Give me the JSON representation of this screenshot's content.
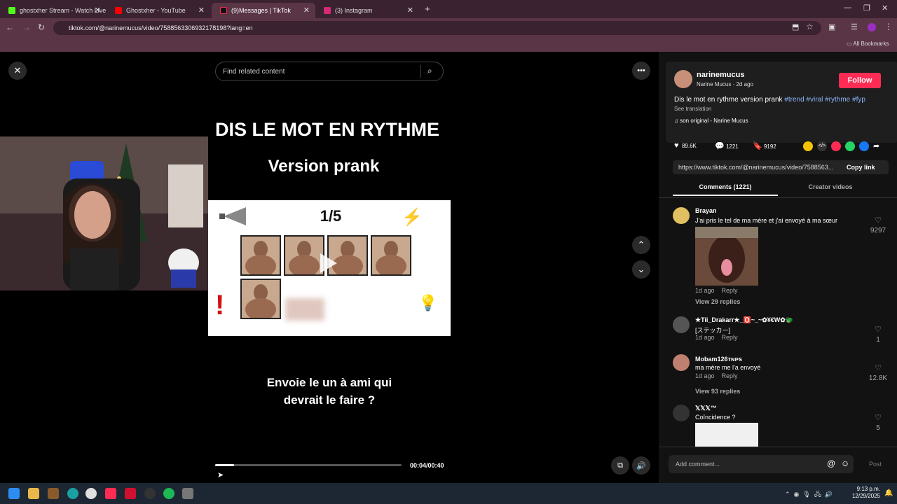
{
  "tabs": [
    {
      "title": "ghostxher Stream - Watch Live",
      "color": "#53fc18"
    },
    {
      "title": "Ghostxher - YouTube",
      "color": "#ff0000"
    },
    {
      "title": "(9)Messages | TikTok",
      "color": "#fe2c55"
    },
    {
      "title": "(3) Instagram",
      "color": "#d62976"
    }
  ],
  "url": "tiktok.com/@narinemucus/video/7588563306932178198?lang=en",
  "bookmarks_label": "All Bookmarks",
  "search_placeholder": "Find related content",
  "video": {
    "title_line1": "DIS LE MOT EN RYTHME",
    "title_line2": "Version prank",
    "counter": "1/5",
    "caption_line1": "Envoie le un à ami qui",
    "caption_line2": "devrait le faire ?",
    "time": "00:04/00:40",
    "progress": 0.1
  },
  "author": {
    "username": "narinemucus",
    "subline": "Narine Mucus · 2d ago",
    "follow_label": "Follow",
    "description": "Dis le mot en rythme version prank",
    "tags": "#trend #viral #rythme #fyp",
    "see_translation": "See translation",
    "sound": "son original - Narine Mucus"
  },
  "stats": {
    "likes": "89.6K",
    "comments": "1221",
    "saves": "9192"
  },
  "share_url": "https://www.tiktok.com/@narinemucus/video/7588563...",
  "copy_link": "Copy link",
  "tabs_panel": {
    "comments": "Comments (1221)",
    "creator": "Creator videos"
  },
  "comments": [
    {
      "name": "Brayan",
      "text": "J'ai pris le tel de ma mère et j'ai envoyé à ma sœur",
      "meta": "1d ago",
      "reply": "Reply",
      "likes": "9297",
      "replies": "View 29 replies"
    },
    {
      "name": "★Tii_Drakarr★_🅾️~_~✿¥€W✿🐲",
      "text": "[ステッカー]",
      "meta": "1d ago",
      "reply": "Reply",
      "likes": "1"
    },
    {
      "name": "Mobam126ᴛɴᴘs",
      "text": "ma mère me l'a envoyé",
      "meta": "1d ago",
      "reply": "Reply",
      "likes": "12.8K",
      "replies": "View 93 replies"
    },
    {
      "name": "𝕏𝕏𝕏™",
      "text": "Coïncidence ?",
      "likes": "5"
    }
  ],
  "add_comment_placeholder": "Add comment...",
  "post_label": "Post",
  "clock": {
    "time": "9:13 p.m.",
    "date": "12/29/2025"
  }
}
